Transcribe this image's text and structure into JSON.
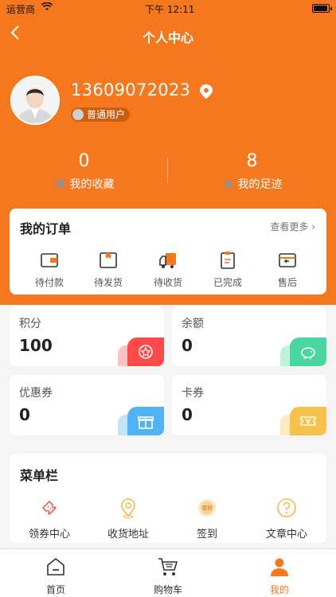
{
  "status_bar": {
    "carrier": "运营商",
    "time": "下午 12:11"
  },
  "nav": {
    "title": "个人中心"
  },
  "profile": {
    "phone": "13609072023",
    "user_level": "普通用户"
  },
  "stats": [
    {
      "value": "0",
      "label": "我的收藏",
      "icon": "favorite-icon"
    },
    {
      "value": "8",
      "label": "我的足迹",
      "icon": "footprint-icon"
    }
  ],
  "orders": {
    "title": "我的订单",
    "more": "查看更多",
    "items": [
      {
        "label": "待付款",
        "icon": "wallet-icon"
      },
      {
        "label": "待发货",
        "icon": "package-icon"
      },
      {
        "label": "待收货",
        "icon": "truck-icon"
      },
      {
        "label": "已完成",
        "icon": "clipboard-icon"
      },
      {
        "label": "售后",
        "icon": "return-icon"
      }
    ]
  },
  "assets": [
    {
      "label": "积分",
      "value": "100",
      "icon": "medal-icon",
      "color": "#ff4a4a"
    },
    {
      "label": "余额",
      "value": "0",
      "icon": "piggy-bank-icon",
      "color": "#49d6a0"
    },
    {
      "label": "优惠券",
      "value": "0",
      "icon": "gift-icon",
      "color": "#4fb3f5"
    },
    {
      "label": "卡券",
      "value": "0",
      "icon": "ticket-icon",
      "color": "#f8c24a"
    }
  ],
  "menu": {
    "title": "菜单栏",
    "items": [
      {
        "label": "领券中心",
        "icon": "coupon-icon"
      },
      {
        "label": "收货地址",
        "icon": "location-icon"
      },
      {
        "label": "签到",
        "icon": "sign-in-icon",
        "badge_text": "签到"
      },
      {
        "label": "文章中心",
        "icon": "question-icon"
      }
    ]
  },
  "tabbar": {
    "items": [
      {
        "label": "首页",
        "icon": "home-icon"
      },
      {
        "label": "购物车",
        "icon": "cart-icon"
      },
      {
        "label": "我的",
        "icon": "user-icon"
      }
    ],
    "active_index": 2
  },
  "colors": {
    "brand": "#f6781e",
    "background": "#f5f5f5"
  }
}
